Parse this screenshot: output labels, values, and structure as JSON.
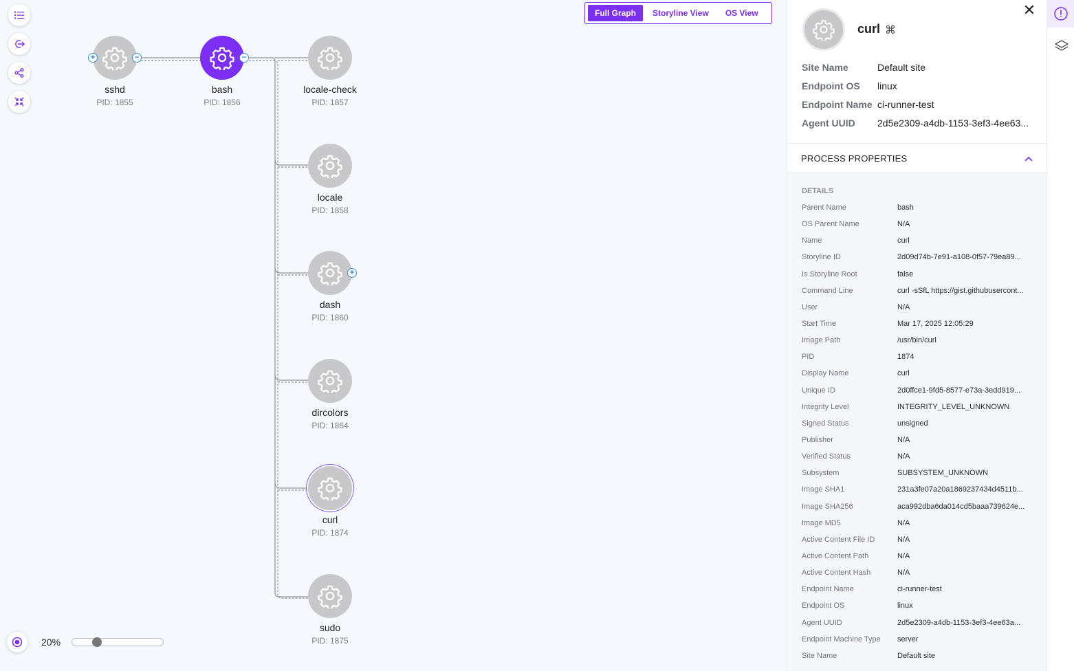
{
  "toolbar": {
    "icons": [
      "list-icon",
      "export-icon",
      "share-icon",
      "collapse-icon"
    ]
  },
  "view_toggle": {
    "options": [
      "Full Graph",
      "Storyline View",
      "OS View"
    ],
    "selected": "Full Graph"
  },
  "graph": {
    "nodes": [
      {
        "name": "sshd",
        "pid": "PID: 1855"
      },
      {
        "name": "bash",
        "pid": "PID: 1856"
      },
      {
        "name": "locale-check",
        "pid": "PID: 1857"
      },
      {
        "name": "locale",
        "pid": "PID: 1858"
      },
      {
        "name": "dash",
        "pid": "PID: 1860"
      },
      {
        "name": "dircolors",
        "pid": "PID: 1864"
      },
      {
        "name": "curl",
        "pid": "PID: 1874"
      },
      {
        "name": "sudo",
        "pid": "PID: 1875"
      }
    ]
  },
  "zoom": {
    "label": "20%",
    "value": 0.2
  },
  "panel": {
    "title": "curl",
    "info": [
      {
        "k": "Site Name",
        "v": "Default site"
      },
      {
        "k": "Endpoint OS",
        "v": "linux"
      },
      {
        "k": "Endpoint Name",
        "v": "ci-runner-test"
      },
      {
        "k": "Agent UUID",
        "v": "2d5e2309-a4db-1153-3ef3-4ee63..."
      }
    ],
    "section_title": "PROCESS PROPERTIES",
    "details_heading": "DETAILS",
    "details": [
      {
        "k": "Parent Name",
        "v": "bash"
      },
      {
        "k": "OS Parent Name",
        "v": "N/A"
      },
      {
        "k": "Name",
        "v": "curl"
      },
      {
        "k": "Storyline ID",
        "v": "2d09d74b-7e91-a108-0f57-79ea89..."
      },
      {
        "k": "Is Storyline Root",
        "v": "false"
      },
      {
        "k": "Command Line",
        "v": "curl -sSfL https://gist.githubusercont..."
      },
      {
        "k": "User",
        "v": "N/A"
      },
      {
        "k": "Start Time",
        "v": "Mar 17, 2025 12:05:29"
      },
      {
        "k": "Image Path",
        "v": "/usr/bin/curl"
      },
      {
        "k": "PID",
        "v": "1874"
      },
      {
        "k": "Display Name",
        "v": "curl"
      },
      {
        "k": "Unique ID",
        "v": "2d0ffce1-9fd5-8577-e73a-3edd919..."
      },
      {
        "k": "Integrity Level",
        "v": "INTEGRITY_LEVEL_UNKNOWN"
      },
      {
        "k": "Signed Status",
        "v": "unsigned"
      },
      {
        "k": "Publisher",
        "v": "N/A"
      },
      {
        "k": "Verified Status",
        "v": "N/A"
      },
      {
        "k": "Subsystem",
        "v": "SUBSYSTEM_UNKNOWN"
      },
      {
        "k": "Image SHA1",
        "v": "231a3fe07a20a1869237434d4511b..."
      },
      {
        "k": "Image SHA256",
        "v": "aca992dba6da014cd5baaa739624e..."
      },
      {
        "k": "Image MD5",
        "v": "N/A"
      },
      {
        "k": "Active Content File ID",
        "v": "N/A"
      },
      {
        "k": "Active Content Path",
        "v": "N/A"
      },
      {
        "k": "Active Content Hash",
        "v": "N/A"
      },
      {
        "k": "Endpoint Name",
        "v": "ci-runner-test"
      },
      {
        "k": "Endpoint OS",
        "v": "linux"
      },
      {
        "k": "Agent UUID",
        "v": "2d5e2309-a4db-1153-3ef3-4ee63a..."
      },
      {
        "k": "Endpoint Machine Type",
        "v": "server"
      },
      {
        "k": "Site Name",
        "v": "Default site"
      }
    ]
  },
  "colors": {
    "accent": "#7b2ff2",
    "node": "#c8c8ca",
    "link": "#3b8fd6"
  }
}
